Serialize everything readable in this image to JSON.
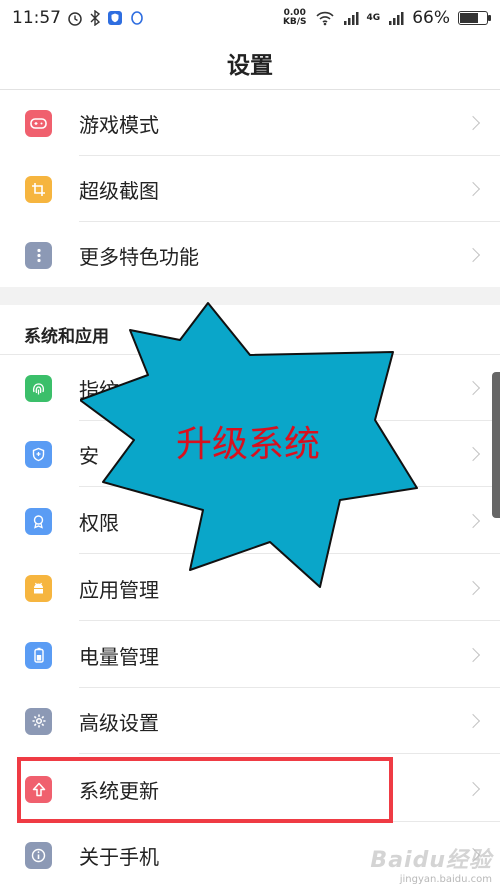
{
  "status_bar": {
    "time": "11:57",
    "net_speed_value": "0.00",
    "net_speed_unit": "KB/S",
    "network_type": "4G",
    "battery": "66%",
    "battery_level": 0.66
  },
  "header": {
    "title": "设置"
  },
  "group1": {
    "items": [
      {
        "label": "游戏模式",
        "icon": "gamepad-icon",
        "color": "#f0606e"
      },
      {
        "label": "超级截图",
        "icon": "screenshot-icon",
        "color": "#f6b53f"
      },
      {
        "label": "更多特色功能",
        "icon": "more-icon",
        "color": "#8c99b5"
      }
    ]
  },
  "section": {
    "title": "系统和应用"
  },
  "group2": {
    "items": [
      {
        "label": "指纹",
        "icon": "fingerprint-icon",
        "color": "#3bbf6a"
      },
      {
        "label": "安",
        "icon": "shield-icon",
        "color": "#5a9cf4"
      },
      {
        "label": "权限",
        "icon": "permission-icon",
        "color": "#5a9cf4"
      },
      {
        "label": "应用管理",
        "icon": "android-icon",
        "color": "#f6b53f"
      },
      {
        "label": "电量管理",
        "icon": "battery-icon",
        "color": "#5a9cf4"
      },
      {
        "label": "高级设置",
        "icon": "gear-icon",
        "color": "#8c99b5"
      },
      {
        "label": "系统更新",
        "icon": "upgrade-icon",
        "color": "#f0606e"
      },
      {
        "label": "关于手机",
        "icon": "info-icon",
        "color": "#8c99b5"
      }
    ]
  },
  "annotation": {
    "text": "升级系统",
    "fill_color": "#0aa6c9",
    "text_color": "#d8101e",
    "highlight_color": "#ef3b44"
  },
  "watermark": {
    "brand": "Baidu经验",
    "domain": "jingyan.baidu.com"
  }
}
